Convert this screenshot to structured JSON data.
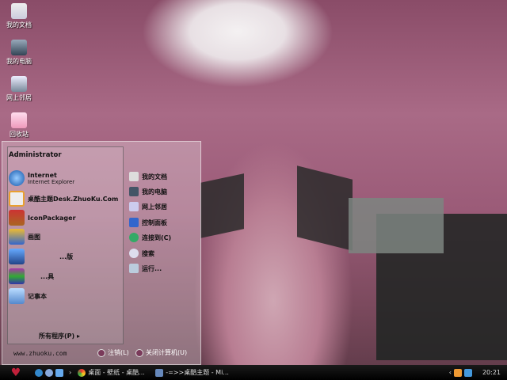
{
  "desktop_icons": [
    {
      "label": "我的文档"
    },
    {
      "label": "我的电脑"
    },
    {
      "label": "网上邻居"
    },
    {
      "label": "回收站"
    }
  ],
  "start_menu": {
    "user": "Administrator",
    "pinned": [
      {
        "title": "Internet",
        "subtitle": "Internet Explorer"
      },
      {
        "title": "桌酷主题Desk.ZhuoKu.Com"
      },
      {
        "title": "IconPackager"
      },
      {
        "title": "画图"
      },
      {
        "title": "...版"
      },
      {
        "title": "...具"
      },
      {
        "title": "记事本"
      }
    ],
    "right_items": [
      {
        "label": "我的文档"
      },
      {
        "label": "我的电脑"
      },
      {
        "label": "网上邻居"
      },
      {
        "label": "控制面板"
      },
      {
        "label": "连接到(C)"
      },
      {
        "label": "搜索"
      },
      {
        "label": "运行..."
      }
    ],
    "all_programs": "所有程序(P)",
    "site": "www.zhuoku.com",
    "logoff": "注销(L)",
    "shutdown": "关闭计算机(U)"
  },
  "taskbar": {
    "tasks": [
      {
        "label": "桌面 - 壁纸 - 桌酷..."
      },
      {
        "label": "-=>>桌酷主题 - Mi..."
      }
    ],
    "clock": "20:21",
    "accent": "#c0203a"
  }
}
